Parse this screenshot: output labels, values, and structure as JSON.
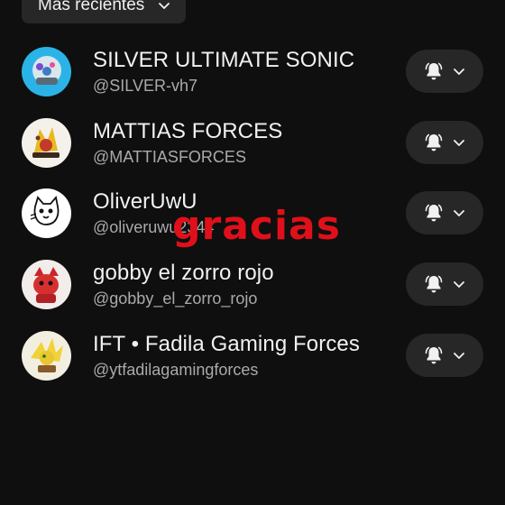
{
  "sort": {
    "label": "Más recientes"
  },
  "channels": [
    {
      "name": "SILVER ULTIMATE SONIC",
      "handle": "@SILVER-vh7"
    },
    {
      "name": "MATTIAS FORCES",
      "handle": "@MATTIASFORCES"
    },
    {
      "name": "OliverUwU",
      "handle": "@oliveruwu2344"
    },
    {
      "name": "gobby el zorro rojo",
      "handle": "@gobby_el_zorro_rojo"
    },
    {
      "name": "IFT • Fadila Gaming Forces",
      "handle": "@ytfadilagamingforces"
    }
  ],
  "overlay": {
    "text": "gracias"
  },
  "icons": {
    "notifications": "bell-icon",
    "dropdown": "chevron-down-icon"
  },
  "colors": {
    "background": "#0f0f0f",
    "chip": "#272727",
    "overlay_text": "#e0101a",
    "secondary_text": "#aaaaaa"
  }
}
